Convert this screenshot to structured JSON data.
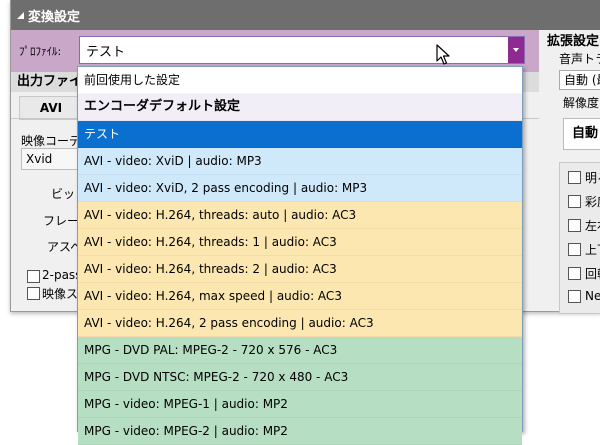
{
  "window": {
    "title": "変換設定"
  },
  "profile": {
    "label": "ﾌﾟﾛﾌｧｲﾙ:",
    "value": "テスト"
  },
  "output": {
    "header": "出力ファイ",
    "tab": "AVI",
    "codec_label": "映像コーデ",
    "codec_value": "Xvid",
    "bitrate_label": "ビット",
    "frame_label": "フレー",
    "aspect_label": "アスペ",
    "pass_label": "2-pass",
    "video_label": "映像ス"
  },
  "right_panel": {
    "title": "拡張設定",
    "audio_track_label": "音声トラッ",
    "audio_track_value": "自動 (最",
    "resolution_label": "解像度",
    "resolution_button": "自動",
    "checkboxes": [
      "明るさ",
      "彩度",
      "左右",
      "上下",
      "回転",
      "Nega"
    ]
  },
  "dropdown": {
    "options": [
      {
        "label": "前回使用した設定",
        "color": "white",
        "bold": false,
        "selected": false
      },
      {
        "label": "エンコーダデフォルト設定",
        "color": "lavender",
        "bold": true,
        "selected": false
      },
      {
        "label": "テスト",
        "color": "selected",
        "bold": false,
        "selected": true
      },
      {
        "label": "AVI - video: XviD | audio: MP3",
        "color": "blue",
        "bold": false,
        "selected": false
      },
      {
        "label": "AVI - video: XviD, 2 pass encoding | audio: MP3",
        "color": "blue",
        "bold": false,
        "selected": false
      },
      {
        "label": "AVI - video: H.264, threads: auto | audio: AC3",
        "color": "yellow",
        "bold": false,
        "selected": false
      },
      {
        "label": "AVI - video: H.264, threads: 1 | audio: AC3",
        "color": "yellow",
        "bold": false,
        "selected": false
      },
      {
        "label": "AVI - video: H.264, threads: 2 | audio: AC3",
        "color": "yellow",
        "bold": false,
        "selected": false
      },
      {
        "label": "AVI - video: H.264, max speed | audio: AC3",
        "color": "yellow",
        "bold": false,
        "selected": false
      },
      {
        "label": "AVI - video: H.264, 2 pass encoding | audio: AC3",
        "color": "yellow",
        "bold": false,
        "selected": false
      },
      {
        "label": "MPG - DVD PAL: MPEG-2 - 720 x 576 - AC3",
        "color": "green",
        "bold": false,
        "selected": false
      },
      {
        "label": "MPG - DVD NTSC: MPEG-2 - 720 x 480 - AC3",
        "color": "green",
        "bold": false,
        "selected": false
      },
      {
        "label": "MPG - video: MPEG-1 | audio: MP2",
        "color": "green",
        "bold": false,
        "selected": false
      },
      {
        "label": "MPG - video: MPEG-2 | audio: MP2",
        "color": "green",
        "bold": false,
        "selected": false
      }
    ]
  },
  "colors": {
    "titlebar": "#6e6e6e",
    "profile_bar": "#c9a7c9",
    "combo_button": "#8e2a91",
    "selected": "#0b6fcf",
    "group_blue": "#cfe9fb",
    "group_yellow": "#fce7b1",
    "group_green": "#b6dec2"
  }
}
